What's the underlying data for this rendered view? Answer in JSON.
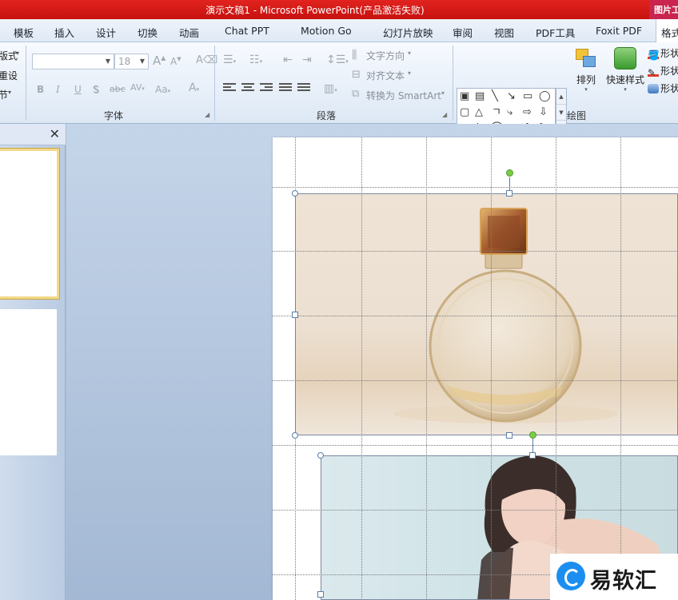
{
  "window": {
    "title": "演示文稿1 - Microsoft PowerPoint(产品激活失败)",
    "tool_tab": "图片工具"
  },
  "tabs": [
    {
      "label": "模板"
    },
    {
      "label": "插入"
    },
    {
      "label": "设计"
    },
    {
      "label": "切换"
    },
    {
      "label": "动画"
    },
    {
      "label": "Chat PPT"
    },
    {
      "label": "Motion Go"
    },
    {
      "label": "幻灯片放映"
    },
    {
      "label": "审阅"
    },
    {
      "label": "视图"
    },
    {
      "label": "PDF工具"
    },
    {
      "label": "Foxit PDF"
    },
    {
      "label": "格式"
    }
  ],
  "ribbon": {
    "slides_group": {
      "layout": "版式",
      "reset": "重设",
      "section": "节"
    },
    "font_group": {
      "label": "字体",
      "font_name_value": "",
      "font_size_value": "18",
      "grow": "A",
      "shrink": "A",
      "bold": "B",
      "italic": "I",
      "underline": "U",
      "shadow": "S",
      "strike": "abc",
      "spacing": "AV",
      "case": "Aa",
      "color": "A"
    },
    "paragraph_group": {
      "label": "段落",
      "text_direction": "文字方向",
      "align_text": "对齐文本",
      "smartart": "转换为 SmartArt"
    },
    "drawing_group": {
      "label": "绘图",
      "arrange": "排列",
      "quick_styles": "快速样式",
      "shape_fill": "形状填充",
      "shape_outline": "形状轮廓",
      "shape_effects": "形状效果"
    }
  },
  "watermark": {
    "text": "易软汇"
  }
}
